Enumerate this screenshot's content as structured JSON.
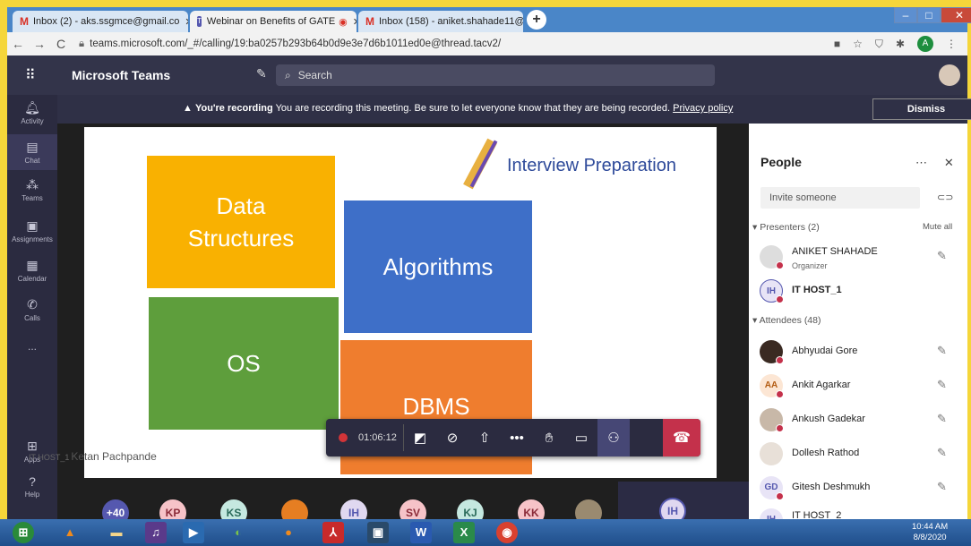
{
  "browser": {
    "tabs": [
      {
        "label": "Inbox (2) - aks.ssgmce@gmail.co",
        "icon": "gmail-icon"
      },
      {
        "label": "Webinar on Benefits of GATE",
        "icon": "teams-icon"
      },
      {
        "label": "Inbox (158) - aniket.shahade11@",
        "icon": "gmail-icon"
      }
    ],
    "url": "teams.microsoft.com/_#/calling/19:ba0257b293b64b0d9e3e7d6b1011ed0e@thread.tacv2/",
    "profile_initial": "A"
  },
  "teams": {
    "app_title": "Microsoft Teams",
    "search_placeholder": "Search",
    "rail": [
      {
        "label": "Activity",
        "icon": "bell-icon"
      },
      {
        "label": "Chat",
        "icon": "chat-icon"
      },
      {
        "label": "Teams",
        "icon": "teams-icon"
      },
      {
        "label": "Assignments",
        "icon": "assignments-icon"
      },
      {
        "label": "Calendar",
        "icon": "calendar-icon"
      },
      {
        "label": "Calls",
        "icon": "phone-icon"
      },
      {
        "label": "...",
        "icon": "more-icon"
      }
    ],
    "rail_bottom": [
      {
        "label": "Apps",
        "icon": "apps-icon"
      },
      {
        "label": "Help",
        "icon": "help-icon"
      }
    ]
  },
  "banner": {
    "bold": "You're recording",
    "text": " You are recording this meeting. Be sure to let everyone know that they are being recorded. ",
    "link": "Privacy policy",
    "dismiss": "Dismiss"
  },
  "slide": {
    "title": "Interview Preparation",
    "boxes": {
      "ds": "Data Structures",
      "algo": "Algorithms",
      "os": "OS",
      "dbms": "DBMS"
    },
    "speaker_name": "Ketan Pachpande",
    "speaker_host": "IT HOST_1"
  },
  "call": {
    "timer": "01:06:12"
  },
  "strip": {
    "avatars": [
      "+40",
      "KP",
      "KS",
      "",
      "IH",
      "SV",
      "KJ",
      "KK",
      ""
    ],
    "self": "IH"
  },
  "people": {
    "title": "People",
    "invite_placeholder": "Invite someone",
    "presenters_header": "Presenters (2)",
    "mute_all": "Mute all",
    "attendees_header": "Attendees (48)",
    "presenters": [
      {
        "initials": "",
        "name": "ANIKET SHAHADE",
        "role": "Organizer"
      },
      {
        "initials": "IH",
        "name": "IT HOST_1",
        "role": ""
      }
    ],
    "attendees": [
      {
        "initials": "",
        "name": "Abhyudai Gore"
      },
      {
        "initials": "AA",
        "name": "Ankit Agarkar"
      },
      {
        "initials": "",
        "name": "Ankush Gadekar"
      },
      {
        "initials": "",
        "name": "Dollesh Rathod"
      },
      {
        "initials": "GD",
        "name": "Gitesh Deshmukh"
      },
      {
        "initials": "IH",
        "name": "IT HOST_2"
      }
    ]
  },
  "taskbar": {
    "time": "10:44 AM",
    "date": "8/8/2020"
  }
}
